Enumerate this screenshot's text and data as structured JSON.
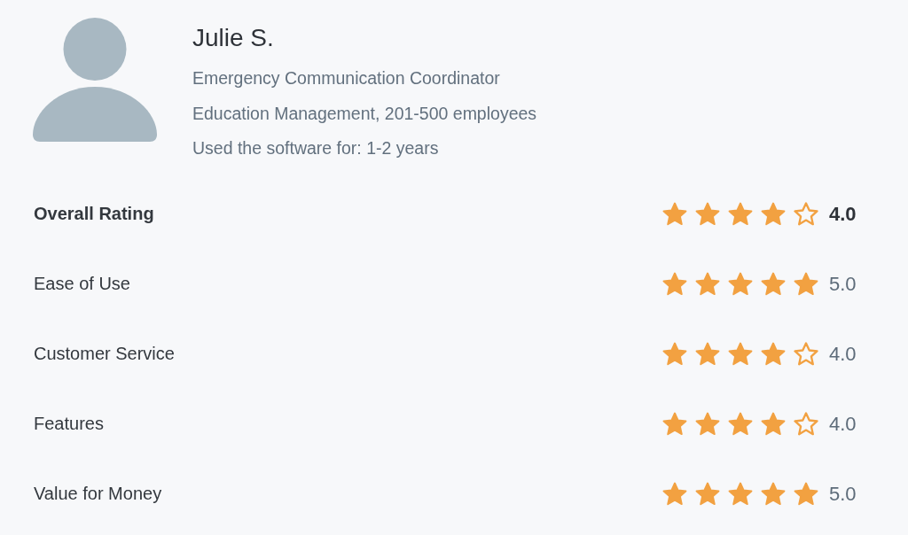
{
  "reviewer": {
    "name": "Julie S.",
    "job_title": "Emergency Communication Coordinator",
    "company": "Education Management, 201-500 employees",
    "usage": "Used the software for: 1-2 years"
  },
  "ratings": [
    {
      "kind": "overall",
      "label": "Overall Rating",
      "stars": 4,
      "score": "4.0"
    },
    {
      "kind": "category",
      "label": "Ease of Use",
      "stars": 5,
      "score": "5.0"
    },
    {
      "kind": "category",
      "label": "Customer Service",
      "stars": 4,
      "score": "4.0"
    },
    {
      "kind": "category",
      "label": "Features",
      "stars": 4,
      "score": "4.0"
    },
    {
      "kind": "category",
      "label": "Value for Money",
      "stars": 5,
      "score": "5.0"
    }
  ]
}
